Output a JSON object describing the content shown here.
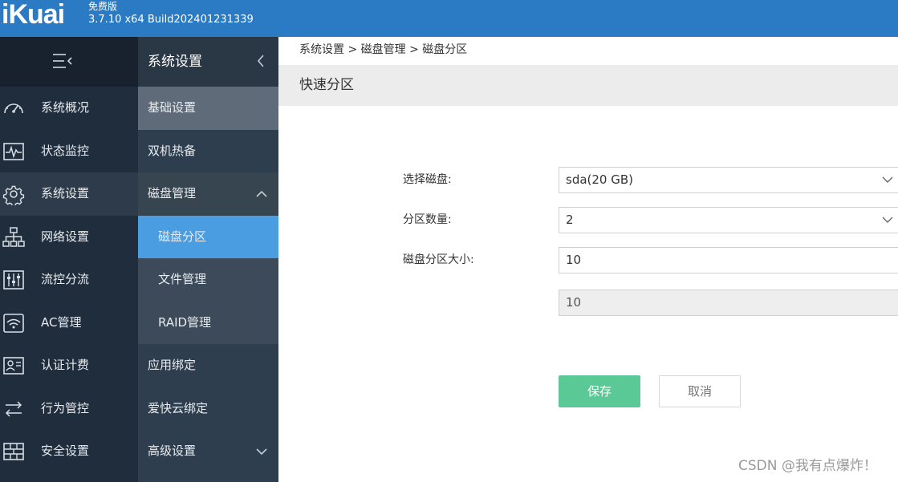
{
  "header": {
    "logo": "iKuai",
    "edition": "免费版",
    "version": "3.7.10 x64 Build202401231339"
  },
  "nav_primary": {
    "items": [
      {
        "label": "系统概况",
        "icon": "dashboard-icon"
      },
      {
        "label": "状态监控",
        "icon": "monitor-icon"
      },
      {
        "label": "系统设置",
        "icon": "gear-icon"
      },
      {
        "label": "网络设置",
        "icon": "network-icon"
      },
      {
        "label": "流控分流",
        "icon": "sliders-icon"
      },
      {
        "label": "AC管理",
        "icon": "wifi-icon"
      },
      {
        "label": "认证计费",
        "icon": "id-card-icon"
      },
      {
        "label": "行为管控",
        "icon": "arrows-icon"
      },
      {
        "label": "安全设置",
        "icon": "firewall-icon"
      }
    ]
  },
  "nav_secondary": {
    "title": "系统设置",
    "items": [
      {
        "label": "基础设置"
      },
      {
        "label": "双机热备"
      },
      {
        "label": "磁盘管理"
      },
      {
        "label": "磁盘分区"
      },
      {
        "label": "文件管理"
      },
      {
        "label": "RAID管理"
      },
      {
        "label": "应用绑定"
      },
      {
        "label": "爱快云绑定"
      },
      {
        "label": "高级设置"
      }
    ]
  },
  "breadcrumb": "系统设置 > 磁盘管理 > 磁盘分区",
  "panel": {
    "title": "快速分区"
  },
  "form": {
    "disk_label": "选择磁盘:",
    "disk_value": "sda(20 GB)",
    "count_label": "分区数量:",
    "count_value": "2",
    "size_label": "磁盘分区大小:",
    "size_value": "10",
    "size_value_2": "10"
  },
  "buttons": {
    "save": "保存",
    "cancel": "取消"
  },
  "watermark": "CSDN @我有点爆炸！",
  "colors": {
    "topbar": "#2a7bc4",
    "nav_primary_bg": "#1f2d3d",
    "nav_secondary_bg": "#2f3e4e",
    "selected": "#4a9de0",
    "save_button": "#5bc996"
  }
}
